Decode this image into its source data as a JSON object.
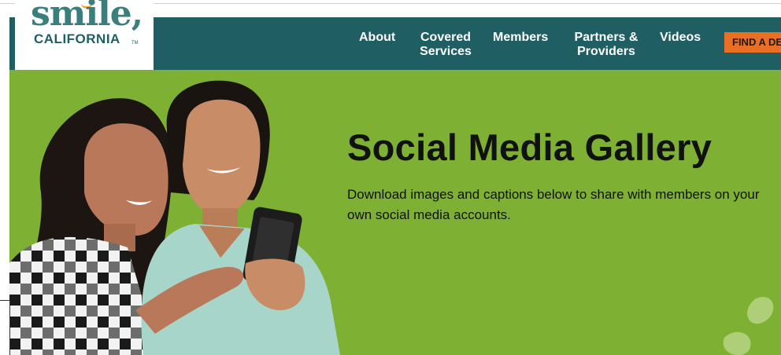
{
  "logo": {
    "word": "smile,",
    "sub": "CALIFORNIA",
    "tm": "TM"
  },
  "nav": {
    "about": "About",
    "covered_line1": "Covered",
    "covered_line2": "Services",
    "members": "Members",
    "partners_line1": "Partners &",
    "partners_line2": "Providers",
    "videos": "Videos",
    "find_button": "FIND A DE"
  },
  "hero": {
    "title": "Social Media Gallery",
    "description": "Download images and captions below to share with members on your own social media accounts."
  },
  "colors": {
    "header_bg": "#1f5f63",
    "hero_bg": "#7db033",
    "button_bg": "#e86f24",
    "logo_teal": "#3b7f7c"
  }
}
